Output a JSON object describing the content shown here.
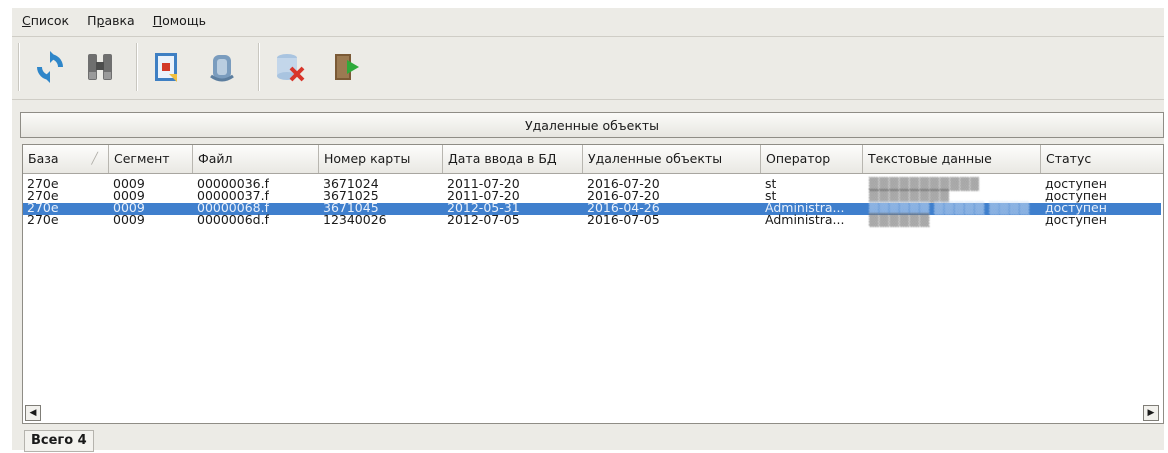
{
  "menu": {
    "items": [
      {
        "pre": "",
        "u": "С",
        "post": "писок"
      },
      {
        "pre": "П",
        "u": "р",
        "post": "авка"
      },
      {
        "pre": "",
        "u": "П",
        "post": "омощь"
      }
    ]
  },
  "toolbar": {
    "buttons": [
      "refresh-icon",
      "binoculars-icon",
      "import-card-icon",
      "restore-record-icon",
      "delete-database-icon",
      "exit-icon"
    ]
  },
  "section": {
    "title": "Удаленные объекты"
  },
  "table": {
    "columns": [
      "База",
      "Сегмент",
      "Файл",
      "Номер карты",
      "Дата ввода в БД",
      "Удаленные объекты",
      "Оператор",
      "Текстовые данные",
      "Статус"
    ],
    "rows": [
      {
        "base": "270e",
        "segment": "0009",
        "file": "00000036.f",
        "card": "3671024",
        "date_in": "2011-07-20",
        "deleted": "2016-07-20",
        "operator": "st",
        "text": "",
        "status": "доступен"
      },
      {
        "base": "270e",
        "segment": "0009",
        "file": "00000037.f",
        "card": "3671025",
        "date_in": "2011-07-20",
        "deleted": "2016-07-20",
        "operator": "st",
        "text": "",
        "status": "доступен"
      },
      {
        "base": "270e",
        "segment": "0009",
        "file": "00000068.f",
        "card": "3671045",
        "date_in": "2012-05-31",
        "deleted": "2016-04-26",
        "operator": "Administra...",
        "text": "",
        "status": "доступен"
      },
      {
        "base": "270e",
        "segment": "0009",
        "file": "0000006d.f",
        "card": "12340026",
        "date_in": "2012-07-05",
        "deleted": "2016-07-05",
        "operator": "Administra...",
        "text": "",
        "status": "доступен"
      }
    ],
    "selected_row": 2
  },
  "status": {
    "label": "Всего 4"
  },
  "colors": {
    "selection": "#3f7fcd",
    "window_bg": "#ecebe6"
  }
}
